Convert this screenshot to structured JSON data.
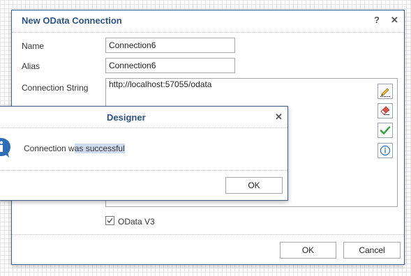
{
  "main_dialog": {
    "title": "New OData Connection",
    "help_label": "?",
    "close_label": "✕",
    "name_label": "Name",
    "name_value": "Connection6",
    "alias_label": "Alias",
    "alias_value": "Connection6",
    "connection_string_label": "Connection String",
    "connection_string_value": "http://localhost:57055/odata",
    "side_buttons": [
      "edit-connection-icon",
      "clear-icon",
      "test-connection-icon",
      "info-icon"
    ],
    "odata_v3_label": "OData V3",
    "odata_v3_checked": true,
    "ok_label": "OK",
    "cancel_label": "Cancel"
  },
  "message_box": {
    "title": "Designer",
    "close_label": "✕",
    "message_part1": "Connection w",
    "message_part2": "as successful",
    "ok_label": "OK",
    "icon": "information-icon"
  },
  "colors": {
    "title_text": "#2e5280",
    "dialog_border": "#3e5f8a",
    "check_green": "#2e9e3e",
    "eraser_red": "#d9534f",
    "info_blue": "#2c6fb7",
    "selection": "#cfdcf0"
  }
}
